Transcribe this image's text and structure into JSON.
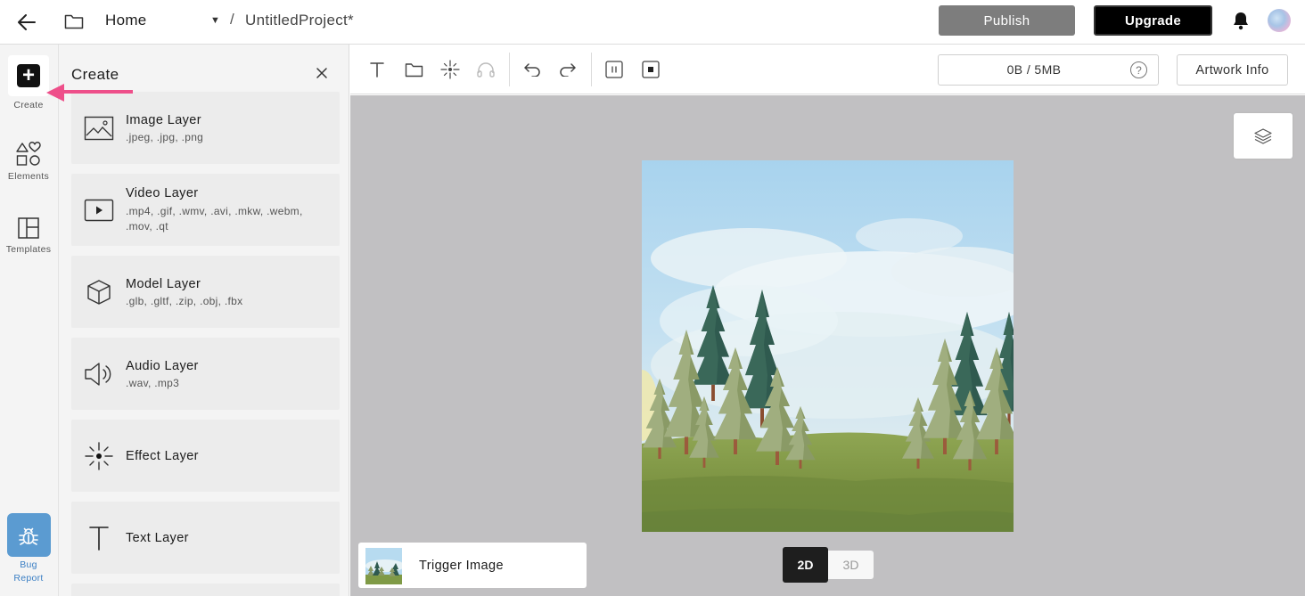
{
  "header": {
    "back_icon": "arrow-left-icon",
    "folder_icon": "folder-icon",
    "home_label": "Home",
    "caret_glyph": "▼",
    "separator": "/",
    "project_name": "UntitledProject*",
    "publish_label": "Publish",
    "upgrade_label": "Upgrade",
    "bell_icon": "bell-icon"
  },
  "rail": {
    "items": [
      {
        "label": "Create",
        "icon": "plus-icon"
      },
      {
        "label": "Elements",
        "icon": "shapes-icon"
      },
      {
        "label": "Templates",
        "icon": "layout-icon"
      }
    ],
    "bug": {
      "line1": "Bug",
      "line2": "Report",
      "icon": "bug-icon"
    }
  },
  "panel": {
    "title": "Create",
    "layers": [
      {
        "title": "Image Layer",
        "formats": ".jpeg, .jpg, .png"
      },
      {
        "title": "Video Layer",
        "formats": ".mp4, .gif, .wmv, .avi, .mkw, .webm, .mov, .qt"
      },
      {
        "title": "Model Layer",
        "formats": ".glb, .gltf, .zip, .obj, .fbx"
      },
      {
        "title": "Audio Layer",
        "formats": ".wav, .mp3"
      },
      {
        "title": "Effect Layer",
        "formats": ""
      },
      {
        "title": "Text Layer",
        "formats": ""
      }
    ]
  },
  "toolbar": {
    "storage_text": "0B / 5MB",
    "help_glyph": "?",
    "artwork_info_label": "Artwork Info"
  },
  "canvas": {
    "trigger_label": "Trigger Image",
    "view_2d": "2D",
    "view_3d": "3D",
    "active_view": "2D"
  },
  "colors": {
    "accent_pink": "#ee4f8a",
    "bug_blue": "#5b9bd1",
    "publish_gray": "#7d7d7d",
    "canvas_gray": "#c1c0c2"
  }
}
